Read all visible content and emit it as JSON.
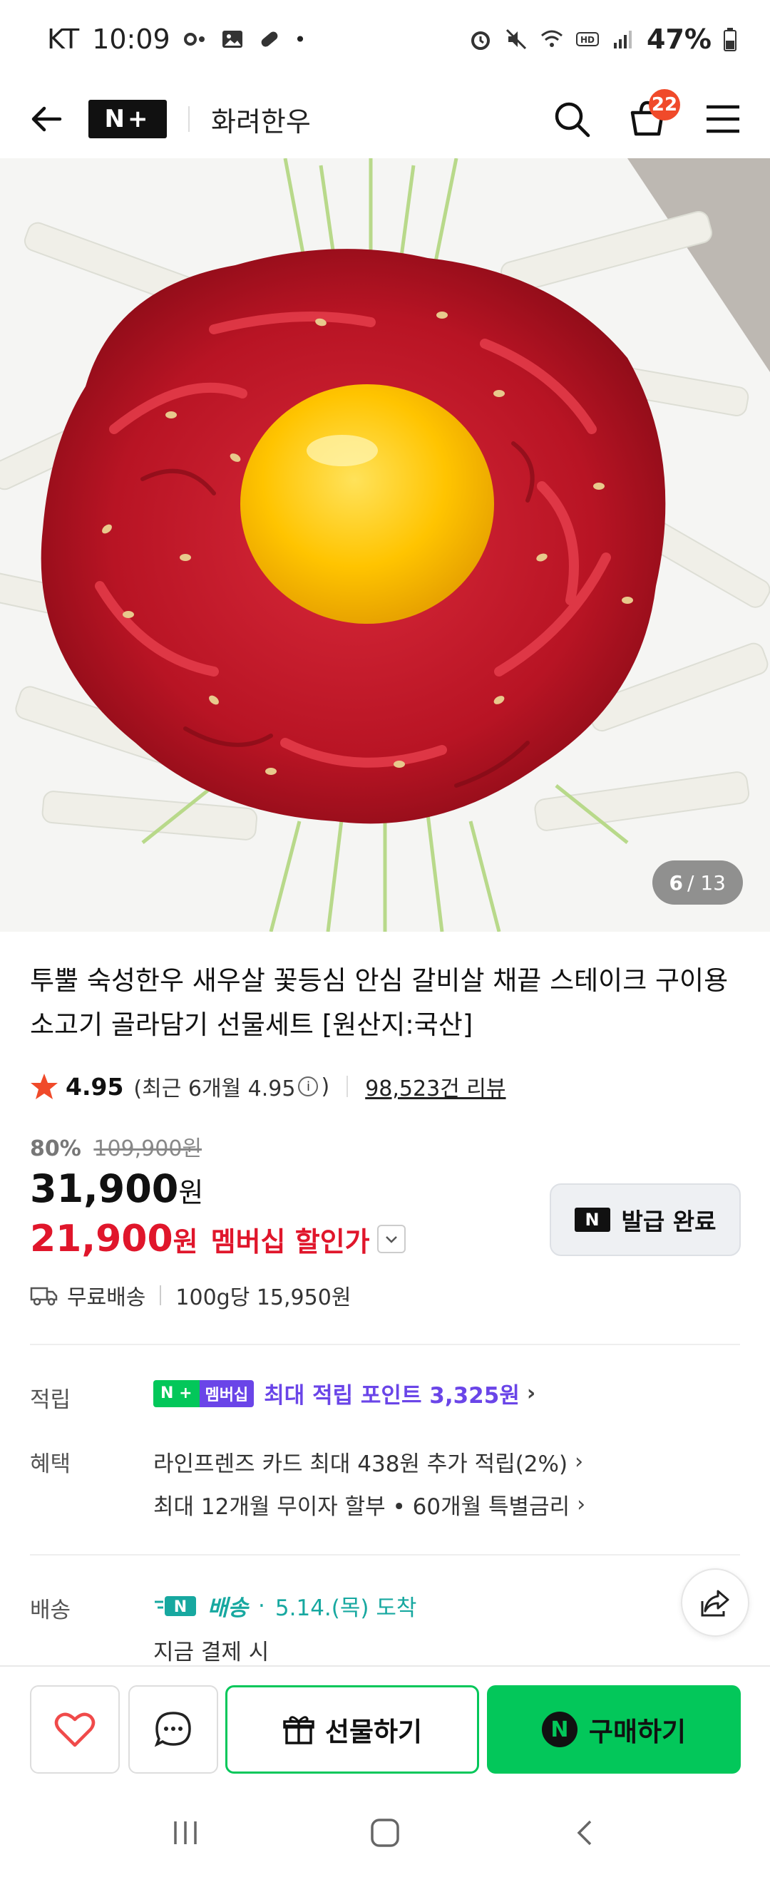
{
  "status_bar": {
    "carrier": "KT",
    "time": "10:09",
    "battery": "47%"
  },
  "header": {
    "brand_badge": "N+",
    "store_name": "화려한우",
    "cart_count": "22"
  },
  "hero": {
    "current_image": "6",
    "total_images": "/ 13"
  },
  "product": {
    "title": "투뿔 숙성한우 새우살 꽃등심 안심 갈비살 채끝 스테이크 구이용 소고기 골라담기 선물세트 [원산지:국산]",
    "rating": "4.95",
    "recent_rating_prefix": "(최근 6개월 4.95",
    "recent_rating_suffix": ")",
    "reviews": "98,523건 리뷰",
    "discount_pct": "80%",
    "original_price": "109,900원",
    "price": "31,900",
    "price_unit": "원",
    "member_price": "21,900",
    "member_price_unit": "원",
    "member_label": "멤버십 할인가",
    "coupon_label": "발급 완료",
    "shipping": "무료배송",
    "unit_price": "100g당 15,950원"
  },
  "details": {
    "points_label": "적립",
    "membership_badge_n": "N +",
    "membership_badge_text": "멤버십",
    "points_text": "최대 적립 포인트 3,325원",
    "benefit_label": "혜택",
    "benefit_1": "라인프렌즈 카드 최대 438원 추가 적립(2%)",
    "benefit_2": "최대 12개월 무이자 할부 • 60개월 특별금리",
    "delivery_label": "배송",
    "delivery_badge": "배송",
    "delivery_date": "5.14.(목) 도착",
    "delivery_note": "지금 결제 시"
  },
  "bottom_bar": {
    "gift_label": "선물하기",
    "buy_label": "구매하기"
  },
  "colors": {
    "naver_green": "#03c75a",
    "member_red": "#e0162b",
    "membership_purple": "#6a45e8",
    "delivery_teal": "#17a8a0",
    "cart_badge": "#f04a2a"
  }
}
